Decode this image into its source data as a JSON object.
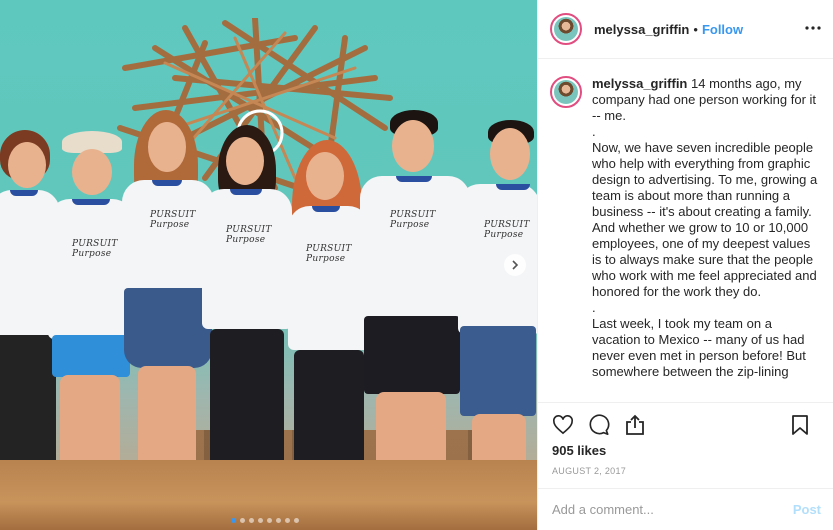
{
  "post": {
    "username": "melyssa_griffin",
    "separator": "•",
    "follow_label": "Follow",
    "more_icon": "more-horizontal-icon"
  },
  "caption": {
    "username": "melyssa_griffin",
    "paragraphs": [
      "14 months ago, my company had one person working for it -- me.",
      ".",
      "Now, we have seven incredible people who help with everything from graphic design to advertising. To me, growing a team is about more than running a business -- it's about creating a family. And whether we grow to 10 or 10,000 employees, one of my deepest values is to always make sure that the people who work with me feel appreciated and honored for the work they do.",
      ".",
      "Last week, I took my team on a vacation to Mexico -- many of us had never even met in person before! But somewhere between the zip-lining"
    ]
  },
  "photo": {
    "shirt_logo_top": "PURSUIT",
    "shirt_logo_bottom": "Purpose",
    "carousel_total": 8,
    "carousel_active_index": 0
  },
  "actions": {
    "like_icon": "heart-icon",
    "comment_icon": "comment-bubble-icon",
    "share_icon": "share-icon",
    "save_icon": "bookmark-icon"
  },
  "likes": "905 likes",
  "date": "AUGUST 2, 2017",
  "comment_box": {
    "placeholder": "Add a comment...",
    "post_label": "Post"
  },
  "colors": {
    "accent": "#3897f0",
    "post_disabled": "#b2dffc",
    "wall": "#5fc8be",
    "collar": "#2a4ea0"
  }
}
